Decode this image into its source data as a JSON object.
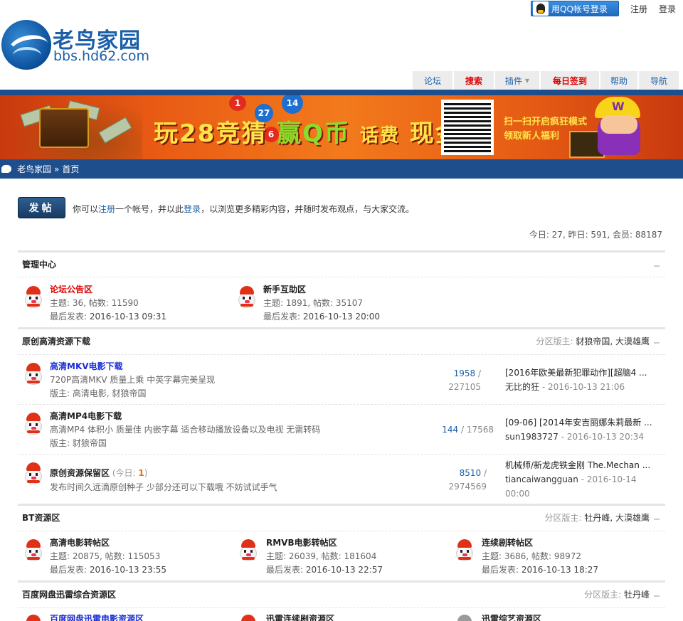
{
  "topbar": {
    "qq_login": "用QQ帐号登录",
    "register": "注册",
    "login": "登录"
  },
  "logo": {
    "name": "老鸟家园",
    "domain": "bbs.hd62.com"
  },
  "nav": [
    {
      "label": "论坛",
      "style": "normal"
    },
    {
      "label": "搜索",
      "style": "red"
    },
    {
      "label": "插件",
      "style": "dropdown"
    },
    {
      "label": "每日签到",
      "style": "red"
    },
    {
      "label": "帮助",
      "style": "normal"
    },
    {
      "label": "导航",
      "style": "normal"
    }
  ],
  "banner": {
    "headline_a": "玩28竞猜",
    "headline_b": "赢Q币",
    "headline_c": "话费",
    "headline_d": "现金",
    "scan_line1": "扫一扫开启疯狂模式",
    "scan_line2": "领取新人福利",
    "balls": [
      "1",
      "14",
      "27",
      "6"
    ]
  },
  "breadcrumb": {
    "home": "老鸟家园",
    "sep": "»",
    "current": "首页"
  },
  "post": {
    "button": "发帖",
    "tip_a": "你可以",
    "tip_register": "注册",
    "tip_b": "一个帐号，并以此",
    "tip_login": "登录",
    "tip_c": "，以浏览更多精彩内容，并随时发布观点，与大家交流。"
  },
  "stats": "今日: 27, 昨日: 591, 会员: 88187",
  "groups": {
    "admin": {
      "title": "管理中心",
      "forums": [
        {
          "name": "论坛公告区",
          "stats": "主题: 36, 帖数: 11590",
          "last_label": "最后发表:",
          "last": "2016-10-13 09:31"
        },
        {
          "name": "新手互助区",
          "stats": "主题: 1891, 帖数: 35107",
          "last_label": "最后发表:",
          "last": "2016-10-13 20:00"
        }
      ]
    },
    "original": {
      "title": "原创高清资源下载",
      "mods_label": "分区版主:",
      "mods": "豺狼帝国, 大漠雄鹰",
      "forums": [
        {
          "name": "高清MKV电影下载",
          "desc": "720P高清MKV 质量上乘 中英字幕完美呈现",
          "mod": "版主: 高清电影, 豺狼帝国",
          "threads": "1958",
          "slash": "/",
          "posts": "227105",
          "last_subject": "[2016年欧美最新犯罪动作][超脑4 ...",
          "last_user": "无比的狂",
          "last_time": "- 2016-10-13 21:06"
        },
        {
          "name": "高清MP4电影下载",
          "desc": "高清MP4 体积小 质量佳 内嵌字幕 适合移动播放设备以及电视 无需转码",
          "mod": "版主: 豺狼帝国",
          "threads": "144",
          "slash": "/",
          "posts": "17568",
          "last_subject": "[09-06] [2014年安吉丽娜朱莉最新 ...",
          "last_user": "sun1983727",
          "last_time": "- 2016-10-13 20:34"
        },
        {
          "name": "原创资源保留区",
          "today_label": "(今日:",
          "today_count": "1",
          "today_end": ")",
          "desc": "发布时间久远滴原创种子 少部分还可以下载哦 不妨试试手气",
          "threads": "8510",
          "slash": "/",
          "posts": "2974569",
          "last_subject": "机械师/新龙虎铁金刚 The.Mechan ...",
          "last_user": "tiancaiwangguan",
          "last_time": "- 2016-10-14",
          "last_time2": "00:00"
        }
      ]
    },
    "bt": {
      "title": "BT资源区",
      "mods_label": "分区版主:",
      "mods": "牡丹峰, 大漠雄鹰",
      "forums": [
        {
          "name": "高清电影转帖区",
          "stats": "主题: 20875, 帖数: 115053",
          "last_label": "最后发表:",
          "last": "2016-10-13 23:55"
        },
        {
          "name": "RMVB电影转帖区",
          "stats": "主题: 26039, 帖数: 181604",
          "last_label": "最后发表:",
          "last": "2016-10-13 22:57"
        },
        {
          "name": "连续剧转帖区",
          "stats": "主题: 3686, 帖数: 98972",
          "last_label": "最后发表:",
          "last": "2016-10-13 18:27"
        }
      ]
    },
    "baidu": {
      "title": "百度网盘迅雷综合资源区",
      "mods_label": "分区版主:",
      "mods": "牡丹峰",
      "forums": [
        {
          "name": "百度网盘迅雷电影资源区"
        },
        {
          "name": "迅雷连续剧资源区"
        },
        {
          "name": "迅雷综艺资源区"
        }
      ]
    }
  },
  "colors": {
    "brand_blue": "#1f4e8c",
    "link_blue": "#1b5fa8",
    "alert_red": "#dd0000",
    "highlight_orange": "#f26c10"
  }
}
